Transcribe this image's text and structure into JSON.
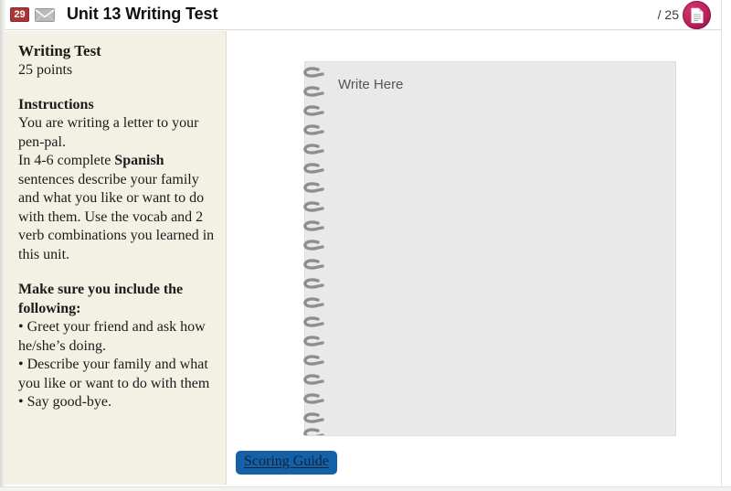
{
  "header": {
    "badge_count": "29",
    "messages_icon": "envelope-icon",
    "title": "Unit 13 Writing Test",
    "score_value": "/ 25",
    "document_icon": "document-icon",
    "badge_color": "#a93636",
    "doc_badge_color": "#c02360"
  },
  "sidebar": {
    "heading": "Writing Test",
    "points": "25 points",
    "instructions_heading": "Instructions",
    "instructions_line1": "You are writing a letter to your pen-pal.",
    "instructions_line2_pre": "In 4-6 complete ",
    "instructions_line2_bold": "Spanish",
    "instructions_line2_post": " sentences describe your family and what you like or want to do with them. Use the vocab and 2 verb combinations you learned in this unit.",
    "include_heading": "Make sure you include the following:",
    "bullets": [
      "• Greet your friend and ask how he/she’s doing.",
      "• Describe your family and what you like or want to do with them",
      "• Say good-bye."
    ],
    "background_color": "#f2f1e3"
  },
  "main": {
    "notepad_placeholder": "Write Here",
    "notepad_background": "#e9e9e9",
    "scoring_guide_label": "Scoring Guide",
    "scoring_guide_highlight_color": "#1461a8"
  }
}
